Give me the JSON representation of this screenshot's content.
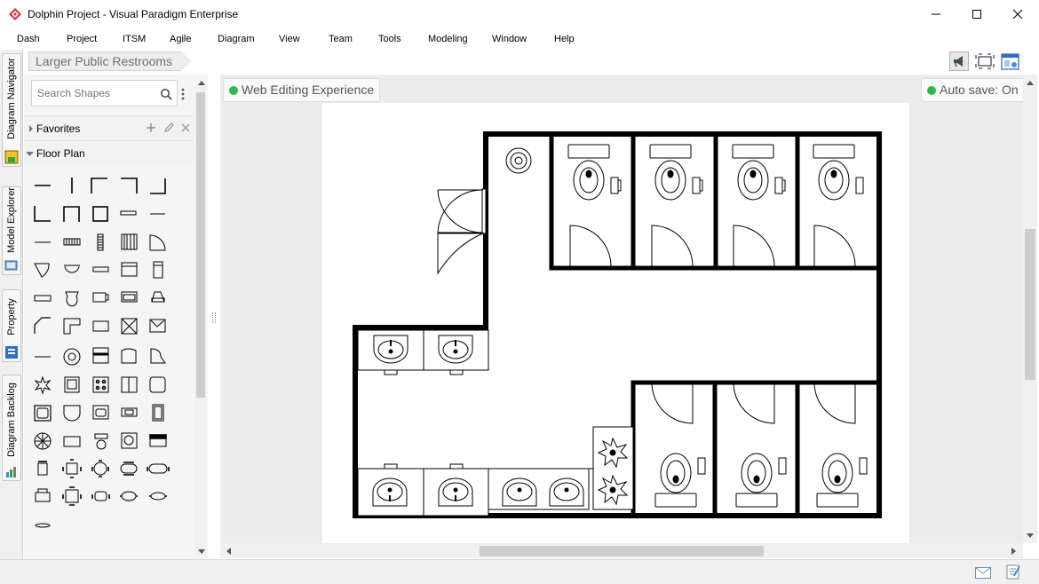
{
  "window": {
    "title": "Dolphin Project - Visual Paradigm Enterprise",
    "controls": {
      "minimize": "—",
      "maximize": "☐",
      "close": "✕"
    }
  },
  "menu": [
    "Dash",
    "Project",
    "ITSM",
    "Agile",
    "Diagram",
    "View",
    "Team",
    "Tools",
    "Modeling",
    "Window",
    "Help"
  ],
  "side_tabs": [
    "Diagram Navigator",
    "Model Explorer",
    "Property",
    "Diagram Backlog"
  ],
  "breadcrumb": "Larger Public Restrooms",
  "shapes_panel": {
    "search_placeholder": "Search Shapes",
    "groups": [
      {
        "label": "Favorites"
      },
      {
        "label": "Floor Plan"
      }
    ]
  },
  "canvas": {
    "status_left": "Web Editing Experience",
    "status_right": "Auto save: On"
  },
  "colors": {
    "status_on": "#2db84b",
    "canvas_bg": "#ececec",
    "panel_bg": "#f5f5f5"
  },
  "icons": {
    "app": "visual-paradigm-logo-icon",
    "search": "search-icon",
    "panel_menu": "kebab-menu-icon",
    "add": "plus-icon",
    "edit": "pencil-icon",
    "remove": "close-icon",
    "toolbar": [
      "announcement-icon",
      "fit-diagram-icon",
      "layout-icon"
    ],
    "status": [
      "mail-icon",
      "notes-icon"
    ]
  }
}
